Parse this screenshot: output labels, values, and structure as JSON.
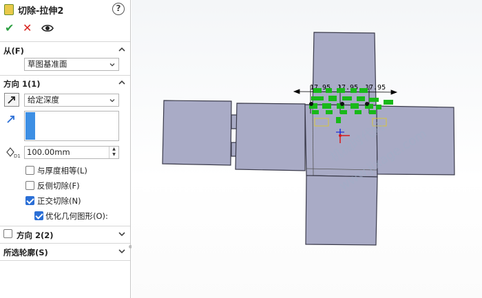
{
  "feature": {
    "title": "切除-拉伸2",
    "help_label": "?"
  },
  "toolbar": {
    "ok_glyph": "✔",
    "cancel_glyph": "✕",
    "preview_icon": "eye-icon"
  },
  "from": {
    "label": "从(F)",
    "value": "草图基准面"
  },
  "direction1": {
    "label": "方向 1(1)",
    "end_condition": "给定深度",
    "depth": "100.00mm",
    "options": [
      {
        "label": "与厚度相等(L)",
        "checked": false
      },
      {
        "label": "反侧切除(F)",
        "checked": false
      },
      {
        "label": "正交切除(N)",
        "checked": true
      },
      {
        "label": "优化几何图形(O):",
        "checked": true
      }
    ]
  },
  "direction2": {
    "label": "方向 2(2)",
    "checked": false
  },
  "contours": {
    "label": "所选轮廓(S)"
  },
  "viewport": {
    "dimensions": [
      "17.95",
      "17.95",
      "17.95"
    ],
    "watermark_line1": "机械时代网",
    "watermark_line2": "www.jixage.com",
    "part_color": "#a9abc6",
    "sketch_color": "#19b919"
  }
}
